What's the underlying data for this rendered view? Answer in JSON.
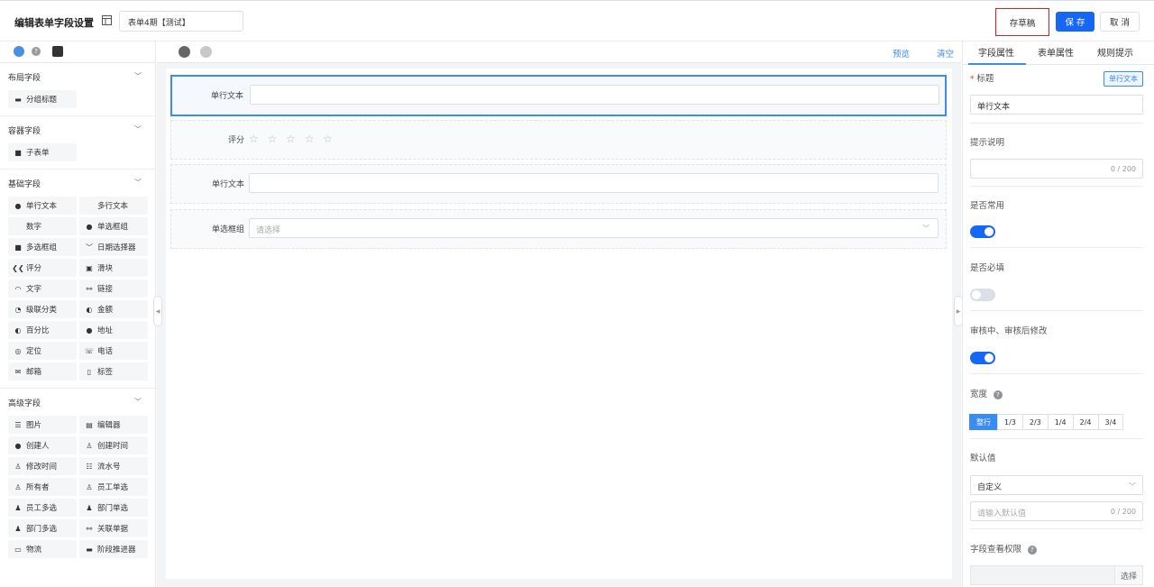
{
  "header": {
    "title": "编辑表单字段设置",
    "form_name": "表单4期【测试】",
    "draft_label": "存草稿",
    "save_label": "保 存",
    "cancel_label": "取 消"
  },
  "left_panel": {
    "sections": [
      {
        "title": "布局字段",
        "items": [
          {
            "label": "分组标题",
            "icon": "group-title-icon"
          }
        ]
      },
      {
        "title": "容器字段",
        "items": [
          {
            "label": "子表单",
            "icon": "subform-icon"
          }
        ]
      },
      {
        "title": "基础字段",
        "items": [
          {
            "label": "单行文本",
            "icon": "text-icon"
          },
          {
            "label": "多行文本",
            "icon": ""
          },
          {
            "label": "数字",
            "icon": ""
          },
          {
            "label": "单选框组",
            "icon": "radio-icon"
          },
          {
            "label": "多选框组",
            "icon": "checkbox-icon"
          },
          {
            "label": "日期选择器",
            "icon": "date-icon"
          },
          {
            "label": "评分",
            "icon": "rating-icon"
          },
          {
            "label": "滑块",
            "icon": "slider-icon"
          },
          {
            "label": "文字",
            "icon": "text-block-icon"
          },
          {
            "label": "链接",
            "icon": "link-icon"
          },
          {
            "label": "级联分类",
            "icon": "cascade-icon"
          },
          {
            "label": "金额",
            "icon": "money-icon"
          },
          {
            "label": "百分比",
            "icon": "percent-icon"
          },
          {
            "label": "地址",
            "icon": "address-icon"
          },
          {
            "label": "定位",
            "icon": "location-icon"
          },
          {
            "label": "电话",
            "icon": "phone-icon"
          },
          {
            "label": "邮箱",
            "icon": "mail-icon"
          },
          {
            "label": "标签",
            "icon": "tag-icon"
          }
        ]
      },
      {
        "title": "高级字段",
        "items": [
          {
            "label": "图片",
            "icon": "image-icon"
          },
          {
            "label": "编辑器",
            "icon": "editor-icon"
          },
          {
            "label": "创建人",
            "icon": "creator-icon"
          },
          {
            "label": "创建时间",
            "icon": "user-icon"
          },
          {
            "label": "修改时间",
            "icon": "user-icon"
          },
          {
            "label": "流水号",
            "icon": "serial-icon"
          },
          {
            "label": "所有者",
            "icon": "user-icon"
          },
          {
            "label": "员工单选",
            "icon": "user-icon"
          },
          {
            "label": "员工多选",
            "icon": "users-icon"
          },
          {
            "label": "部门单选",
            "icon": "users-icon"
          },
          {
            "label": "部门多选",
            "icon": "users-icon"
          },
          {
            "label": "关联单据",
            "icon": "link-icon"
          },
          {
            "label": "物流",
            "icon": "truck-icon"
          },
          {
            "label": "阶段推进器",
            "icon": "stage-icon"
          }
        ]
      }
    ]
  },
  "canvas": {
    "preview_label": "预览",
    "clear_label": "清空",
    "fields": [
      {
        "label": "单行文本",
        "type": "text",
        "placeholder": ""
      },
      {
        "label": "评分",
        "type": "rating",
        "stars": "☆ ☆ ☆ ☆ ☆"
      },
      {
        "label": "单行文本",
        "type": "text",
        "placeholder": ""
      },
      {
        "label": "单选框组",
        "type": "select",
        "placeholder": "请选择"
      }
    ]
  },
  "right_panel": {
    "tabs": [
      "字段属性",
      "表单属性",
      "规则提示"
    ],
    "title_label": "标题",
    "title_type_tag": "单行文本",
    "title_value": "单行文本",
    "hint_label": "提示说明",
    "hint_counter": "0 / 200",
    "common_label": "是否常用",
    "common_on": true,
    "required_label": "是否必填",
    "required_on": false,
    "review_label": "审核中、审核后修改",
    "review_on": true,
    "width_label": "宽度",
    "width_options": [
      "整行",
      "1/3",
      "2/3",
      "1/4",
      "2/4",
      "3/4"
    ],
    "width_selected": "整行",
    "default_label": "默认值",
    "default_mode": "自定义",
    "default_placeholder": "请输入默认值",
    "default_counter": "0 / 200",
    "perm_label": "字段查看权限",
    "perm_button": "选择"
  },
  "colors": {
    "accent": "#1767f5",
    "link": "#3b8bf5",
    "draft_border": "#e01e1e"
  }
}
